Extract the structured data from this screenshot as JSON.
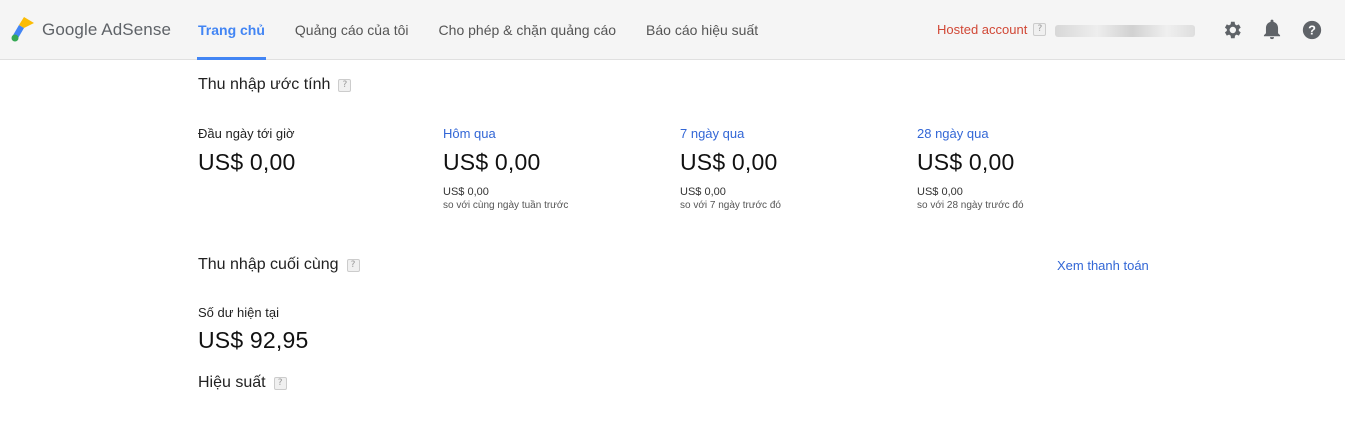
{
  "app": {
    "name": "Google AdSense"
  },
  "nav": {
    "tabs": [
      {
        "label": "Trang chủ",
        "active": true
      },
      {
        "label": "Quảng cáo của tôi",
        "active": false
      },
      {
        "label": "Cho phép & chặn quảng cáo",
        "active": false
      },
      {
        "label": "Báo cáo hiệu suất",
        "active": false
      }
    ]
  },
  "header": {
    "hosted_account": "Hosted account",
    "help_glyph": "?",
    "icons": [
      "gear-icon",
      "bell-icon",
      "help-circle-icon"
    ]
  },
  "estimated": {
    "title": "Thu nhập ước tính",
    "cards": [
      {
        "label": "Đầu ngày tới giờ",
        "value": "US$ 0,00",
        "sub_value": "",
        "sub_text": ""
      },
      {
        "label": "Hôm qua",
        "value": "US$ 0,00",
        "sub_value": "US$ 0,00",
        "sub_text": "so với cùng ngày tuần trước"
      },
      {
        "label": "7 ngày qua",
        "value": "US$ 0,00",
        "sub_value": "US$ 0,00",
        "sub_text": "so với 7 ngày trước đó"
      },
      {
        "label": "28 ngày qua",
        "value": "US$ 0,00",
        "sub_value": "US$ 0,00",
        "sub_text": "so với 28 ngày trước đó"
      }
    ]
  },
  "final": {
    "title": "Thu nhập cuối cùng",
    "view_payments": "Xem thanh toán",
    "balance_label": "Số dư hiện tại",
    "balance_value": "US$ 92,95"
  },
  "performance": {
    "title": "Hiệu suất"
  },
  "colors": {
    "accent": "#4285f4",
    "link": "#3367d6",
    "hosted": "#d14836",
    "topbar_bg": "#f5f5f5"
  }
}
